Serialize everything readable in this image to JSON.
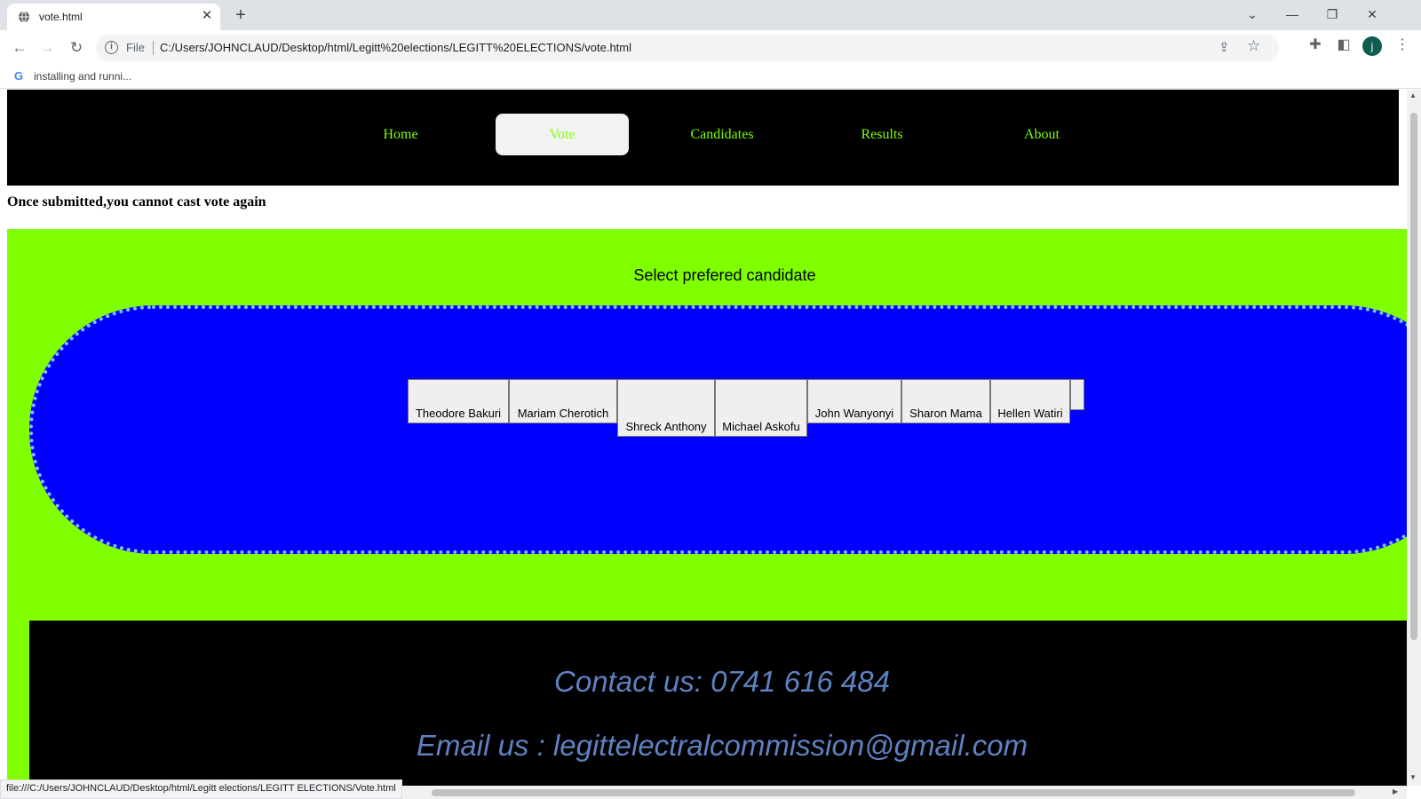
{
  "browser": {
    "tab_title": "vote.html",
    "tab_close": "✕",
    "new_tab": "+",
    "window_controls": {
      "tab_search": "⌄",
      "minimize": "—",
      "restore": "❐",
      "close": "✕"
    },
    "nav": {
      "back": "←",
      "forward": "→",
      "reload": "↻"
    },
    "address": {
      "scheme": "File",
      "url": "C:/Users/JOHNCLAUD/Desktop/html/Legitt%20elections/LEGITT%20ELECTIONS/vote.html"
    },
    "bookmark": {
      "icon": "G",
      "label": "installing and runni..."
    },
    "avatar_letter": "j",
    "status_url": "file:///C:/Users/JOHNCLAUD/Desktop/html/Legitt elections/LEGITT ELECTIONS/Vote.html"
  },
  "page": {
    "nav": {
      "items": [
        {
          "label": "Home",
          "active": false
        },
        {
          "label": "Vote",
          "active": true
        },
        {
          "label": "Candidates",
          "active": false
        },
        {
          "label": "Results",
          "active": false
        },
        {
          "label": "About",
          "active": false
        }
      ]
    },
    "warning": "Once submitted,you cannot cast vote again",
    "vote_heading": "Select prefered candidate",
    "candidates": [
      "Theodore Bakuri",
      "Mariam Cherotich",
      "Shreck Anthony",
      "Michael Askofu",
      "John Wanyonyi",
      "Sharon Mama",
      "Hellen Watiri",
      ""
    ],
    "footer": {
      "contact": "Contact us: 0741 616 484",
      "email": "Email us : legittelectralcommission@gmail.com"
    }
  },
  "colors": {
    "nav_text": "#7fff00",
    "section_bg": "#7fff00",
    "ballot_bg": "#0000ff",
    "footer_text": "#5f81c1"
  }
}
